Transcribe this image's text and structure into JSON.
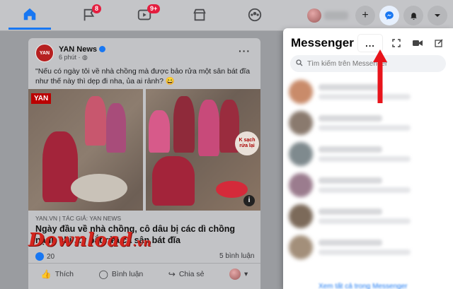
{
  "nav": {
    "badges": {
      "flag": "8",
      "watch": "9+"
    },
    "tabs": [
      "home",
      "pages",
      "watch",
      "marketplace",
      "groups"
    ]
  },
  "icons": {
    "home": "home-icon",
    "flag": "flag-icon",
    "watch": "video-icon",
    "marketplace": "store-icon",
    "groups": "groups-icon",
    "create": "plus-icon",
    "messenger": "messenger-icon",
    "notifications": "bell-icon",
    "account": "chevron-down-icon"
  },
  "post": {
    "author": "YAN News",
    "time": "6 phút · ",
    "text": "\"Nếu có ngày tôi về nhà chồng mà được bảo rửa một sân bát đĩa như thế này thì dẹp đi nha, ủa ai rảnh? 😄",
    "image_logo": "YAN",
    "image_caption": "K sạch rửa lại",
    "link_source": "YAN.VN | TÁC GIẢ: YAN NEWS",
    "link_title": "Ngày đầu về nhà chồng, cô dâu bị các dì chồng nạnh chỉ ...y bắt rửa cả sân bát đĩa",
    "reaction_count": "20",
    "comments": "5 bình luận",
    "actions": {
      "like": "Thích",
      "comment": "Bình luận",
      "share": "Chia sẻ"
    }
  },
  "watermark": {
    "main": "Download",
    "suffix": ".vn"
  },
  "messenger": {
    "title": "Messenger",
    "more_label": "...",
    "search_placeholder": "Tìm kiếm trên Messenger",
    "see_all": "Xem tất cả trong Messenger"
  },
  "colors": {
    "accent": "#1877f2",
    "badge": "#e41e3f",
    "annotation_arrow": "#e8141b",
    "watermark": "#d3251e"
  }
}
